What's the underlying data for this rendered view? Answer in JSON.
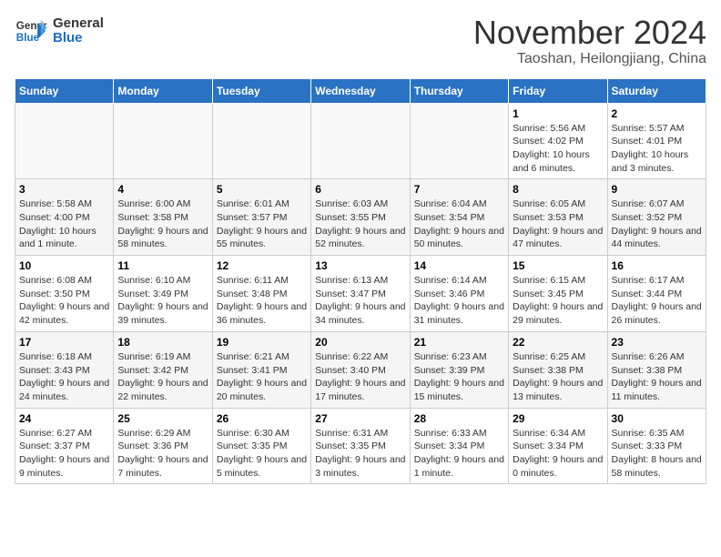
{
  "header": {
    "logo_line1": "General",
    "logo_line2": "Blue",
    "title": "November 2024",
    "subtitle": "Taoshan, Heilongjiang, China"
  },
  "calendar": {
    "days_of_week": [
      "Sunday",
      "Monday",
      "Tuesday",
      "Wednesday",
      "Thursday",
      "Friday",
      "Saturday"
    ],
    "weeks": [
      [
        {
          "day": "",
          "info": ""
        },
        {
          "day": "",
          "info": ""
        },
        {
          "day": "",
          "info": ""
        },
        {
          "day": "",
          "info": ""
        },
        {
          "day": "",
          "info": ""
        },
        {
          "day": "1",
          "info": "Sunrise: 5:56 AM\nSunset: 4:02 PM\nDaylight: 10 hours and 6 minutes."
        },
        {
          "day": "2",
          "info": "Sunrise: 5:57 AM\nSunset: 4:01 PM\nDaylight: 10 hours and 3 minutes."
        }
      ],
      [
        {
          "day": "3",
          "info": "Sunrise: 5:58 AM\nSunset: 4:00 PM\nDaylight: 10 hours and 1 minute."
        },
        {
          "day": "4",
          "info": "Sunrise: 6:00 AM\nSunset: 3:58 PM\nDaylight: 9 hours and 58 minutes."
        },
        {
          "day": "5",
          "info": "Sunrise: 6:01 AM\nSunset: 3:57 PM\nDaylight: 9 hours and 55 minutes."
        },
        {
          "day": "6",
          "info": "Sunrise: 6:03 AM\nSunset: 3:55 PM\nDaylight: 9 hours and 52 minutes."
        },
        {
          "day": "7",
          "info": "Sunrise: 6:04 AM\nSunset: 3:54 PM\nDaylight: 9 hours and 50 minutes."
        },
        {
          "day": "8",
          "info": "Sunrise: 6:05 AM\nSunset: 3:53 PM\nDaylight: 9 hours and 47 minutes."
        },
        {
          "day": "9",
          "info": "Sunrise: 6:07 AM\nSunset: 3:52 PM\nDaylight: 9 hours and 44 minutes."
        }
      ],
      [
        {
          "day": "10",
          "info": "Sunrise: 6:08 AM\nSunset: 3:50 PM\nDaylight: 9 hours and 42 minutes."
        },
        {
          "day": "11",
          "info": "Sunrise: 6:10 AM\nSunset: 3:49 PM\nDaylight: 9 hours and 39 minutes."
        },
        {
          "day": "12",
          "info": "Sunrise: 6:11 AM\nSunset: 3:48 PM\nDaylight: 9 hours and 36 minutes."
        },
        {
          "day": "13",
          "info": "Sunrise: 6:13 AM\nSunset: 3:47 PM\nDaylight: 9 hours and 34 minutes."
        },
        {
          "day": "14",
          "info": "Sunrise: 6:14 AM\nSunset: 3:46 PM\nDaylight: 9 hours and 31 minutes."
        },
        {
          "day": "15",
          "info": "Sunrise: 6:15 AM\nSunset: 3:45 PM\nDaylight: 9 hours and 29 minutes."
        },
        {
          "day": "16",
          "info": "Sunrise: 6:17 AM\nSunset: 3:44 PM\nDaylight: 9 hours and 26 minutes."
        }
      ],
      [
        {
          "day": "17",
          "info": "Sunrise: 6:18 AM\nSunset: 3:43 PM\nDaylight: 9 hours and 24 minutes."
        },
        {
          "day": "18",
          "info": "Sunrise: 6:19 AM\nSunset: 3:42 PM\nDaylight: 9 hours and 22 minutes."
        },
        {
          "day": "19",
          "info": "Sunrise: 6:21 AM\nSunset: 3:41 PM\nDaylight: 9 hours and 20 minutes."
        },
        {
          "day": "20",
          "info": "Sunrise: 6:22 AM\nSunset: 3:40 PM\nDaylight: 9 hours and 17 minutes."
        },
        {
          "day": "21",
          "info": "Sunrise: 6:23 AM\nSunset: 3:39 PM\nDaylight: 9 hours and 15 minutes."
        },
        {
          "day": "22",
          "info": "Sunrise: 6:25 AM\nSunset: 3:38 PM\nDaylight: 9 hours and 13 minutes."
        },
        {
          "day": "23",
          "info": "Sunrise: 6:26 AM\nSunset: 3:38 PM\nDaylight: 9 hours and 11 minutes."
        }
      ],
      [
        {
          "day": "24",
          "info": "Sunrise: 6:27 AM\nSunset: 3:37 PM\nDaylight: 9 hours and 9 minutes."
        },
        {
          "day": "25",
          "info": "Sunrise: 6:29 AM\nSunset: 3:36 PM\nDaylight: 9 hours and 7 minutes."
        },
        {
          "day": "26",
          "info": "Sunrise: 6:30 AM\nSunset: 3:35 PM\nDaylight: 9 hours and 5 minutes."
        },
        {
          "day": "27",
          "info": "Sunrise: 6:31 AM\nSunset: 3:35 PM\nDaylight: 9 hours and 3 minutes."
        },
        {
          "day": "28",
          "info": "Sunrise: 6:33 AM\nSunset: 3:34 PM\nDaylight: 9 hours and 1 minute."
        },
        {
          "day": "29",
          "info": "Sunrise: 6:34 AM\nSunset: 3:34 PM\nDaylight: 9 hours and 0 minutes."
        },
        {
          "day": "30",
          "info": "Sunrise: 6:35 AM\nSunset: 3:33 PM\nDaylight: 8 hours and 58 minutes."
        }
      ]
    ]
  }
}
